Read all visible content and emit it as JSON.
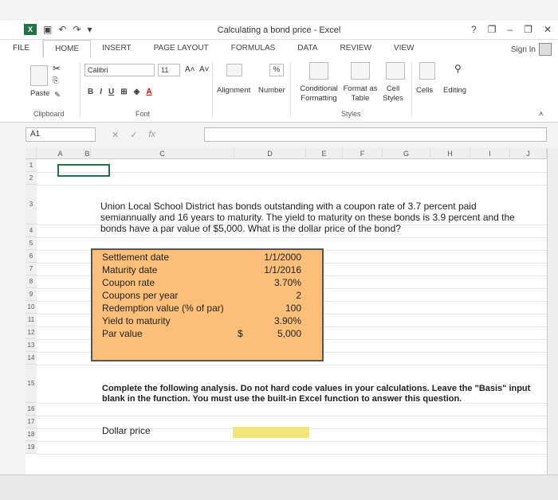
{
  "window": {
    "title": "Calculating a bond price - Excel",
    "help": "?",
    "minimize": "–",
    "restore": "❐",
    "close": "✕"
  },
  "qat": {
    "undo": "↶",
    "redo": "↷",
    "customize": "▾"
  },
  "tabs": [
    "FILE",
    "HOME",
    "INSERT",
    "PAGE LAYOUT",
    "FORMULAS",
    "DATA",
    "REVIEW",
    "VIEW"
  ],
  "sign_in": "Sign In",
  "ribbon": {
    "paste": "Paste",
    "clipboard": "Clipboard",
    "font_name": "Calibri",
    "font_size": "11",
    "bold": "B",
    "italic": "I",
    "underline": "U",
    "font_group": "Font",
    "alignment": "Alignment",
    "number": "Number",
    "number_icon": "%",
    "cond_format": "Conditional Formatting",
    "format_table": "Format as Table",
    "cell_styles": "Cell Styles",
    "styles_group": "Styles",
    "cells": "Cells",
    "editing": "Editing"
  },
  "formula_bar": {
    "name_box": "A1",
    "fx": "fx",
    "value": ""
  },
  "columns": [
    "A",
    "B",
    "C",
    "D",
    "E",
    "F",
    "G",
    "H",
    "I",
    "J"
  ],
  "rows": [
    "1",
    "2",
    "3",
    "4",
    "5",
    "6",
    "7",
    "8",
    "9",
    "10",
    "11",
    "12",
    "13",
    "14",
    "15",
    "16",
    "17",
    "18",
    "19"
  ],
  "question": "Union Local School District has bonds outstanding with a coupon rate of 3.7 percent paid semiannually and 16 years to maturity. The yield to maturity on these bonds is 3.9 percent and the bonds have a par value of $5,000. What is the dollar price of the bond?",
  "inputs": [
    {
      "label": "Settlement date",
      "value": "1/1/2000"
    },
    {
      "label": "Maturity date",
      "value": "1/1/2016"
    },
    {
      "label": "Coupon rate",
      "value": "3.70%"
    },
    {
      "label": "Coupons per year",
      "value": "2"
    },
    {
      "label": "Redemption value (% of par)",
      "value": "100"
    },
    {
      "label": "Yield to maturity",
      "value": "3.90%"
    },
    {
      "label": "Par value",
      "value": "5,000",
      "currency": "$"
    }
  ],
  "instructions": "Complete the following analysis. Do not hard code values in your calculations. Leave the \"Basis\" input blank in the function. You must use the built-in Excel function to answer this question.",
  "output_label": "Dollar price",
  "output_value": ""
}
